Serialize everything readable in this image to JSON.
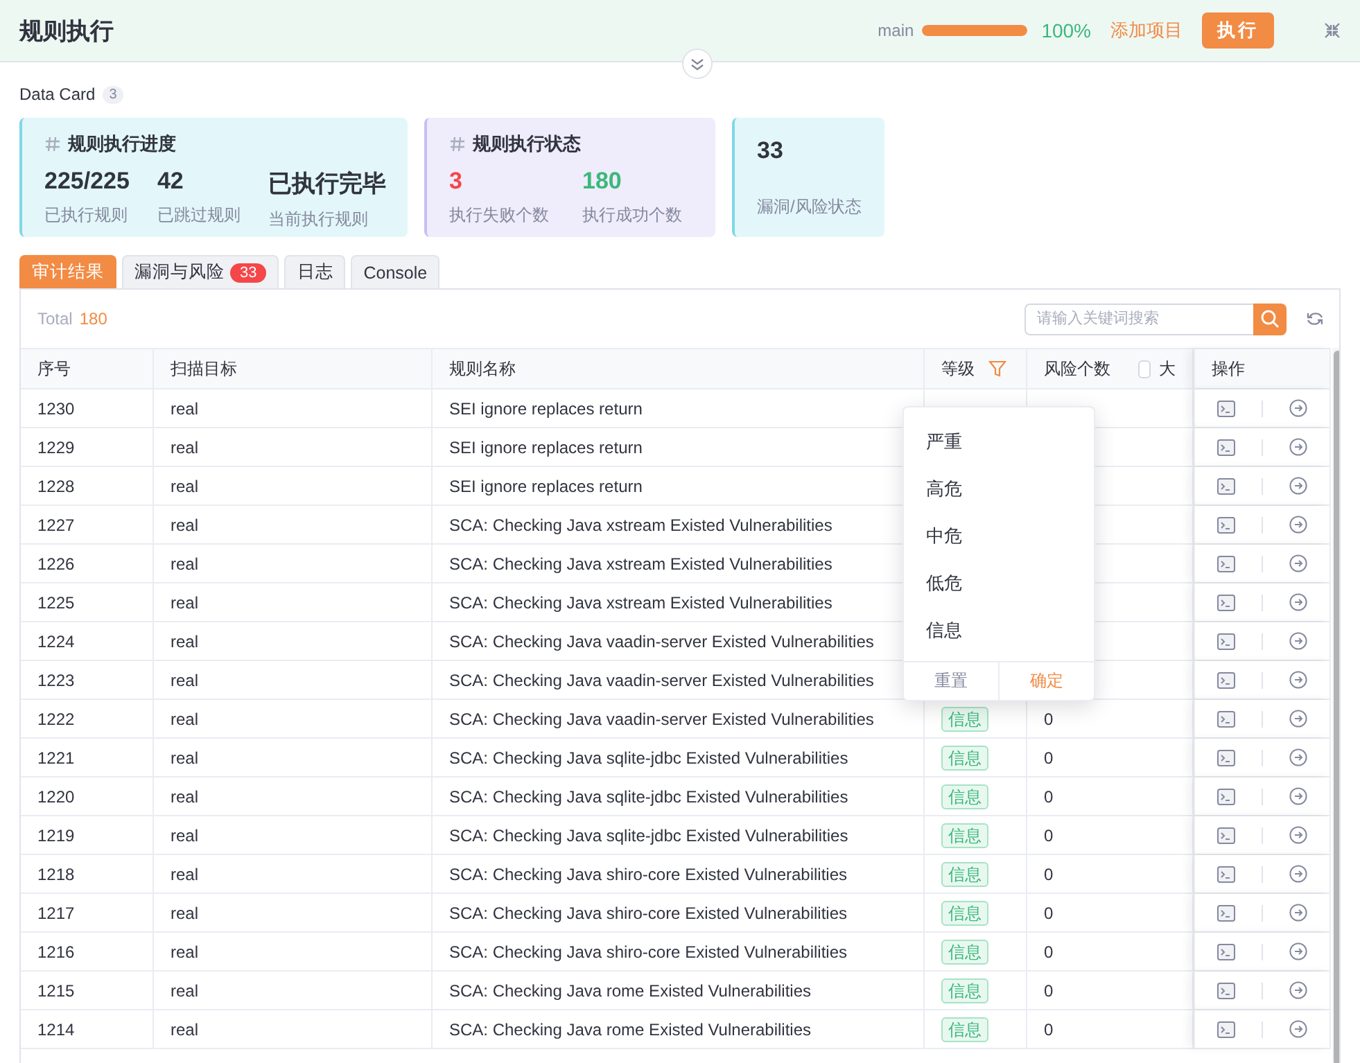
{
  "header": {
    "title": "规则执行",
    "branch": "main",
    "progress": {
      "level": 1,
      "reading": "100%"
    },
    "add_button": "添加项目",
    "run_button": "执行"
  },
  "data_card": {
    "title": "Data Card",
    "count": "3",
    "cards": [
      {
        "title": "规则执行进度",
        "color": "#e3f7fa",
        "stats": [
          {
            "value": "225/225",
            "label": "已执行规则"
          },
          {
            "value": "42",
            "label": "已跳过规则"
          },
          {
            "value": "已执行完毕",
            "label": "当前执行规则"
          }
        ]
      },
      {
        "title": "规则执行状态",
        "color": "#efecfb",
        "stats": [
          {
            "value": "3",
            "label": "执行失败个数",
            "color": "#f5464a"
          },
          {
            "value": "180",
            "label": "执行成功个数",
            "color": "#3bb87a"
          }
        ]
      },
      {
        "color": "#e3f7fa",
        "stats": [
          {
            "value": "33",
            "label": "漏洞/风险状态"
          }
        ]
      }
    ]
  },
  "tabs": [
    {
      "label": "审计结果",
      "selected": true
    },
    {
      "label": "漏洞与风险",
      "badge": "33",
      "selected": false
    },
    {
      "label": "日志",
      "selected": false
    },
    {
      "label": "Console",
      "selected": false
    }
  ],
  "results": {
    "total_label": "Total",
    "total": "180",
    "search": {
      "placeholder": "请输入关键词搜索"
    },
    "columns": [
      "序号",
      "扫描目标",
      "规则名称",
      "等级",
      "风险个数",
      "操作"
    ],
    "count_filter": {
      "label": "大",
      "checked": false
    },
    "rows": [
      {
        "id": "1230",
        "target": "real",
        "rule": "SEI ignore replaces return"
      },
      {
        "id": "1229",
        "target": "real",
        "rule": "SEI ignore replaces return"
      },
      {
        "id": "1228",
        "target": "real",
        "rule": "SEI ignore replaces return"
      },
      {
        "id": "1227",
        "target": "real",
        "rule": "SCA: Checking Java xstream Existed Vulnerabilities"
      },
      {
        "id": "1226",
        "target": "real",
        "rule": "SCA: Checking Java xstream Existed Vulnerabilities"
      },
      {
        "id": "1225",
        "target": "real",
        "rule": "SCA: Checking Java xstream Existed Vulnerabilities"
      },
      {
        "id": "1224",
        "target": "real",
        "rule": "SCA: Checking Java vaadin-server Existed Vulnerabilities"
      },
      {
        "id": "1223",
        "target": "real",
        "rule": "SCA: Checking Java vaadin-server Existed Vulnerabilities"
      },
      {
        "id": "1222",
        "target": "real",
        "rule": "SCA: Checking Java vaadin-server Existed Vulnerabilities",
        "level": "信息",
        "count": "0"
      },
      {
        "id": "1221",
        "target": "real",
        "rule": "SCA: Checking Java sqlite-jdbc Existed Vulnerabilities",
        "level": "信息",
        "count": "0"
      },
      {
        "id": "1220",
        "target": "real",
        "rule": "SCA: Checking Java sqlite-jdbc Existed Vulnerabilities",
        "level": "信息",
        "count": "0"
      },
      {
        "id": "1219",
        "target": "real",
        "rule": "SCA: Checking Java sqlite-jdbc Existed Vulnerabilities",
        "level": "信息",
        "count": "0"
      },
      {
        "id": "1218",
        "target": "real",
        "rule": "SCA: Checking Java shiro-core Existed Vulnerabilities",
        "level": "信息",
        "count": "0"
      },
      {
        "id": "1217",
        "target": "real",
        "rule": "SCA: Checking Java shiro-core Existed Vulnerabilities",
        "level": "信息",
        "count": "0"
      },
      {
        "id": "1216",
        "target": "real",
        "rule": "SCA: Checking Java shiro-core Existed Vulnerabilities",
        "level": "信息",
        "count": "0"
      },
      {
        "id": "1215",
        "target": "real",
        "rule": "SCA: Checking Java rome Existed Vulnerabilities",
        "level": "信息",
        "count": "0"
      },
      {
        "id": "1214",
        "target": "real",
        "rule": "SCA: Checking Java rome Existed Vulnerabilities",
        "level": "信息",
        "count": "0"
      }
    ],
    "level_filter": {
      "options": [
        "严重",
        "高危",
        "中危",
        "低危",
        "信息"
      ],
      "reset": "重置",
      "confirm": "确定"
    }
  }
}
